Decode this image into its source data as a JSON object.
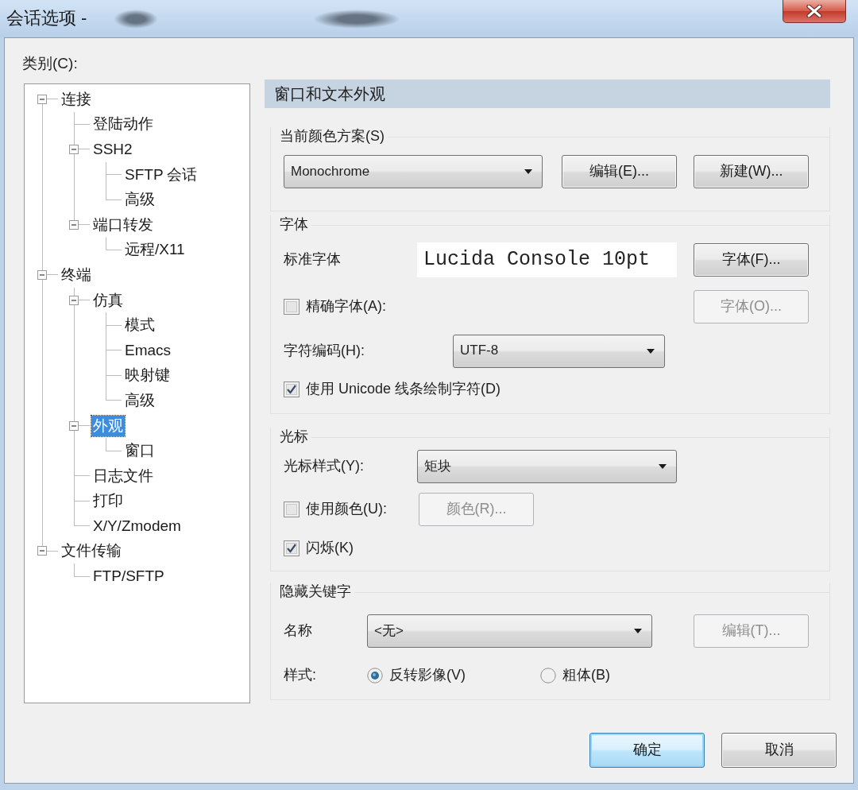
{
  "window": {
    "title": "会话选项 -"
  },
  "category_label": "类别(C):",
  "tree": [
    {
      "label": "连接",
      "selected": false,
      "expanded": true,
      "children": [
        {
          "label": "登陆动作",
          "selected": false
        },
        {
          "label": "SSH2",
          "selected": false,
          "expanded": true,
          "children": [
            {
              "label": "SFTP 会话",
              "selected": false
            },
            {
              "label": "高级",
              "selected": false
            }
          ]
        },
        {
          "label": "端口转发",
          "selected": false,
          "expanded": true,
          "children": [
            {
              "label": "远程/X11",
              "selected": false
            }
          ]
        }
      ]
    },
    {
      "label": "终端",
      "selected": false,
      "expanded": true,
      "children": [
        {
          "label": "仿真",
          "selected": false,
          "expanded": true,
          "children": [
            {
              "label": "模式",
              "selected": false
            },
            {
              "label": "Emacs",
              "selected": false
            },
            {
              "label": "映射键",
              "selected": false
            },
            {
              "label": "高级",
              "selected": false
            }
          ]
        },
        {
          "label": "外观",
          "selected": true,
          "expanded": true,
          "children": [
            {
              "label": "窗口",
              "selected": false
            }
          ]
        },
        {
          "label": "日志文件",
          "selected": false
        },
        {
          "label": "打印",
          "selected": false
        },
        {
          "label": "X/Y/Zmodem",
          "selected": false
        }
      ]
    },
    {
      "label": "文件传输",
      "selected": false,
      "expanded": true,
      "children": [
        {
          "label": "FTP/SFTP",
          "selected": false
        }
      ]
    }
  ],
  "panel": {
    "title": "窗口和文本外观",
    "color_scheme": {
      "title": "当前颜色方案(S)",
      "value": "Monochrome",
      "buttons": [
        {
          "label": "编辑(E)...",
          "disabled": false
        },
        {
          "label": "新建(W)...",
          "disabled": false
        }
      ]
    },
    "font": {
      "title": "字体",
      "standard": {
        "label": "标准字体",
        "value": "Lucida Console 10pt",
        "button": {
          "label": "字体(F)...",
          "disabled": false
        }
      },
      "precise": {
        "label": "精确字体(A):",
        "checked": false,
        "button": {
          "label": "字体(O)...",
          "disabled": true
        }
      },
      "encoding": {
        "label": "字符编码(H):",
        "value": "UTF-8"
      },
      "unicode_lines": {
        "label": "使用 Unicode 线条绘制字符(D)",
        "checked": true
      }
    },
    "cursor": {
      "title": "光标",
      "style": {
        "label": "光标样式(Y):",
        "value": "矩块"
      },
      "use_color": {
        "label": "使用颜色(U):",
        "checked": false,
        "button": {
          "label": "颜色(R)...",
          "disabled": true
        }
      },
      "blink": {
        "label": "闪烁(K)",
        "checked": true
      }
    },
    "keywords": {
      "title": "隐藏关键字",
      "name": {
        "label": "名称",
        "value": "<无>",
        "button": {
          "label": "编辑(T)...",
          "disabled": true
        }
      },
      "style": {
        "label": "样式:",
        "options": [
          {
            "label": "反转影像(V)",
            "selected": true
          },
          {
            "label": "粗体(B)",
            "selected": false
          }
        ]
      }
    }
  },
  "footer": {
    "buttons": [
      {
        "label": "确定",
        "default": true
      },
      {
        "label": "取消",
        "default": false
      }
    ]
  }
}
